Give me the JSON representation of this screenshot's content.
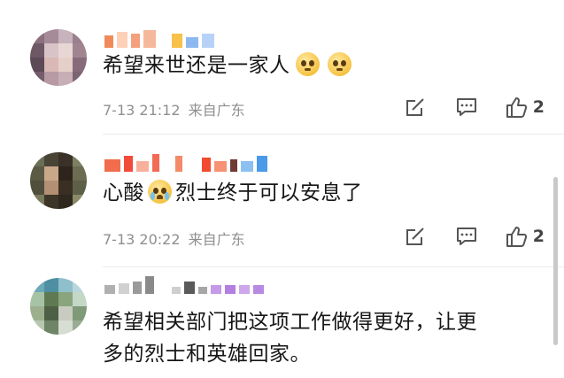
{
  "comments": [
    {
      "text_before": "希望来世还是一家人",
      "emojis": [
        "pleading-face-emoji",
        "pleading-face-emoji"
      ],
      "time": "7-13 21:12",
      "location": "来自广东",
      "likes": "2"
    },
    {
      "text_before": "心酸",
      "emoji": "crying-face-emoji",
      "text_after": "烈士终于可以安息了",
      "time": "7-13 20:22",
      "location": "来自广东",
      "likes": "2"
    },
    {
      "text_line1": "希望相关部门把这项工作做得更好，让更",
      "text_line2": "多的烈士和英雄回家。"
    }
  ],
  "icons": [
    "repost-icon",
    "comment-icon",
    "thumbs-up-icon"
  ],
  "colors": {
    "text": "#161616",
    "meta": "#8f8f8f",
    "icon": "#555555"
  }
}
